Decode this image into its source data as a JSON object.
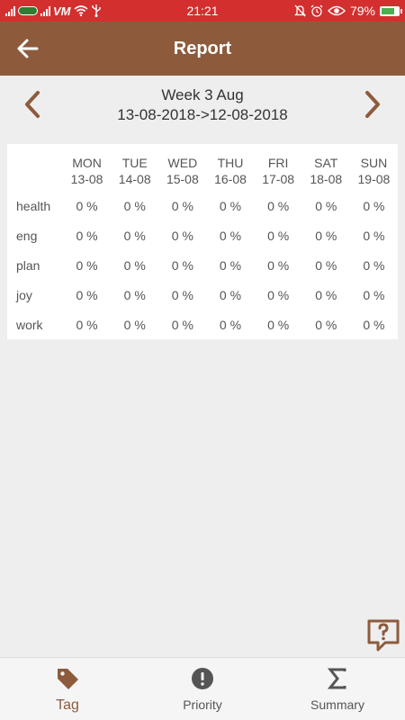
{
  "status_bar": {
    "time": "21:21",
    "battery": "79%",
    "battery_level": 0.79,
    "icons": [
      "signal-icon",
      "carrier-icon",
      "signal-icon",
      "viettel-icon",
      "wifi-icon",
      "usb-icon",
      "bell-off-icon",
      "alarm-icon",
      "eye-icon",
      "battery-icon"
    ]
  },
  "app_bar": {
    "title": "Report",
    "back_icon": "arrow-left-icon"
  },
  "week": {
    "title": "Week 3 Aug",
    "range": "13-08-2018->12-08-2018",
    "prev_icon": "chevron-left-icon",
    "next_icon": "chevron-right-icon"
  },
  "table": {
    "days": [
      {
        "name": "MON",
        "date": "13-08"
      },
      {
        "name": "TUE",
        "date": "14-08"
      },
      {
        "name": "WED",
        "date": "15-08"
      },
      {
        "name": "THU",
        "date": "16-08"
      },
      {
        "name": "FRI",
        "date": "17-08"
      },
      {
        "name": "SAT",
        "date": "18-08"
      },
      {
        "name": "SUN",
        "date": "19-08"
      }
    ],
    "rows": [
      {
        "tag": "health",
        "values": [
          "0 %",
          "0 %",
          "0 %",
          "0 %",
          "0 %",
          "0 %",
          "0 %"
        ]
      },
      {
        "tag": "eng",
        "values": [
          "0 %",
          "0 %",
          "0 %",
          "0 %",
          "0 %",
          "0 %",
          "0 %"
        ]
      },
      {
        "tag": "plan",
        "values": [
          "0 %",
          "0 %",
          "0 %",
          "0 %",
          "0 %",
          "0 %",
          "0 %"
        ]
      },
      {
        "tag": "joy",
        "values": [
          "0 %",
          "0 %",
          "0 %",
          "0 %",
          "0 %",
          "0 %",
          "0 %"
        ]
      },
      {
        "tag": "work",
        "values": [
          "0 %",
          "0 %",
          "0 %",
          "0 %",
          "0 %",
          "0 %",
          "0 %"
        ]
      }
    ]
  },
  "help_icon": "help-chat-icon",
  "bottom_nav": [
    {
      "label": "Tag",
      "icon": "tag-icon",
      "active": true
    },
    {
      "label": "Priority",
      "icon": "exclamation-circle-icon",
      "active": false
    },
    {
      "label": "Summary",
      "icon": "sigma-icon",
      "active": false
    }
  ],
  "colors": {
    "status_bar": "#d32f2f",
    "primary": "#8d5b3c",
    "background": "#eeeeee",
    "inactive_icon": "#555555"
  }
}
